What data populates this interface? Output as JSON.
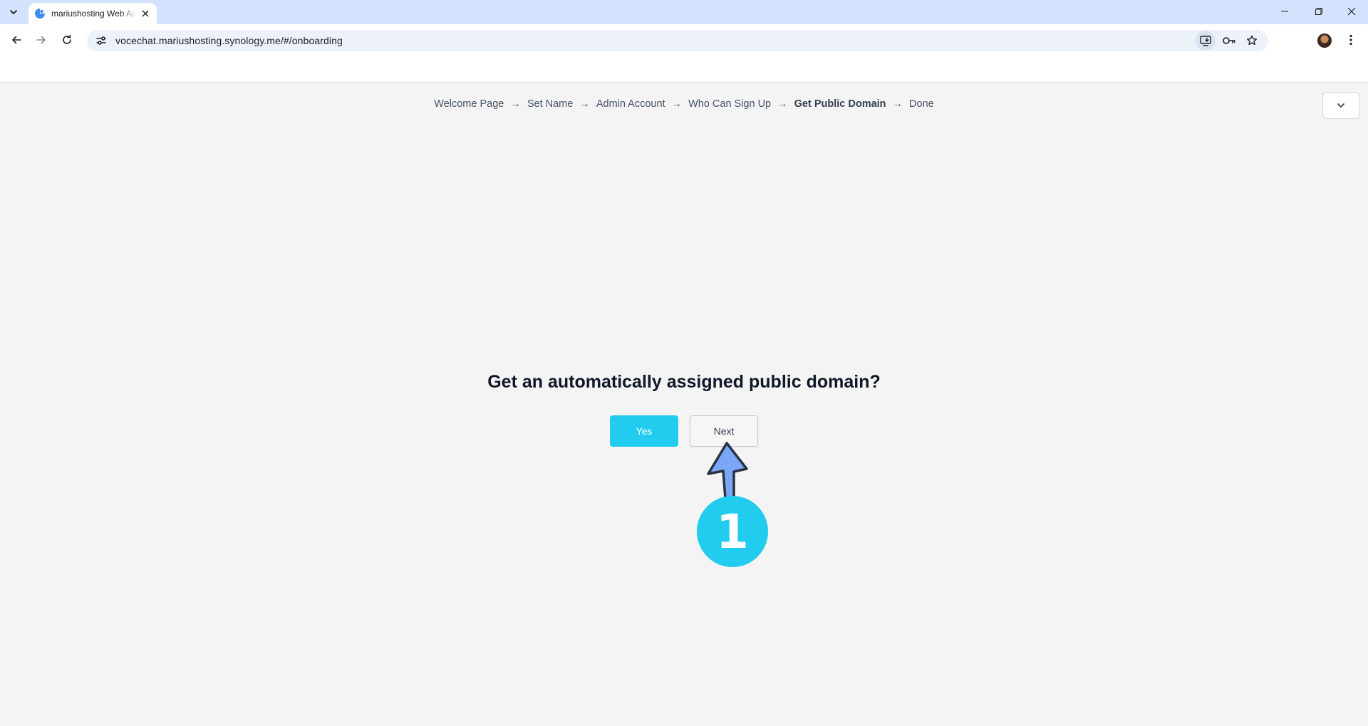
{
  "browser": {
    "tab_title": "mariushosting Web App",
    "url": "vocechat.mariushosting.synology.me/#/onboarding",
    "accent": "#d3e3fd"
  },
  "onboarding": {
    "steps": [
      {
        "label": "Welcome Page",
        "current": false
      },
      {
        "label": "Set Name",
        "current": false
      },
      {
        "label": "Admin Account",
        "current": false
      },
      {
        "label": "Who Can Sign Up",
        "current": false
      },
      {
        "label": "Get Public Domain",
        "current": true
      },
      {
        "label": "Done",
        "current": false
      }
    ],
    "step_separator": "→",
    "question": "Get an automatically assigned public domain?",
    "yes_label": "Yes",
    "next_label": "Next",
    "primary_color": "#22ccee"
  },
  "annotation": {
    "number": "1",
    "arrow_color": "#7aa7f7",
    "badge_color": "#22ccee"
  }
}
